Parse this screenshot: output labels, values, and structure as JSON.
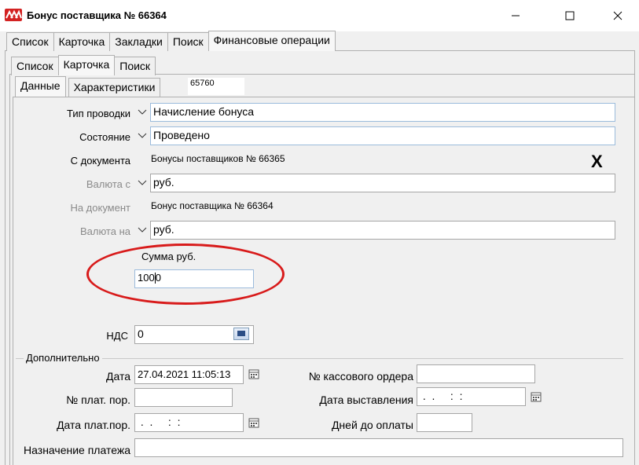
{
  "window": {
    "title": "Бонус поставщика № 66364"
  },
  "tabs_top": [
    "Список",
    "Карточка",
    "Закладки",
    "Поиск",
    "Финансовые операции"
  ],
  "tabs_mid": [
    "Список",
    "Карточка",
    "Поиск"
  ],
  "tabs_inner": [
    "Данные",
    "Характеристики"
  ],
  "record_id": "65760",
  "form": {
    "tip_label": "Тип проводки",
    "tip_value": "Начисление бонуса",
    "state_label": "Состояние",
    "state_value": "Проведено",
    "from_doc_label": "С документа",
    "from_doc_value": "Бонусы поставщиков № 66365",
    "currency_from_label": "Валюта с",
    "currency_from_value": "руб.",
    "to_doc_label": "На документ",
    "to_doc_value": "Бонус поставщика № 66364",
    "currency_to_label": "Валюта на",
    "currency_to_value": "руб.",
    "clear_mark": "X",
    "sum_label": "Сумма  руб.",
    "sum_value_a": "100",
    "sum_value_b": "0",
    "vat_label": "НДС",
    "vat_value": "0"
  },
  "extra": {
    "group_title": "Дополнительно",
    "date_label": "Дата",
    "date_value": "27.04.2021 11:05:13",
    "cash_order_label": "№ кассового ордера",
    "cash_order_value": "",
    "payment_no_label": "№ плат. пор.",
    "payment_no_value": "",
    "issue_date_label": "Дата выставления",
    "issue_date_value": " .  .     :  :",
    "payment_date_label": "Дата плат.пор.",
    "payment_date_value": " .  .     :  :",
    "days_label": "Дней до оплаты",
    "days_value": "",
    "purpose_label": "Назначение платежа",
    "purpose_value": ""
  }
}
